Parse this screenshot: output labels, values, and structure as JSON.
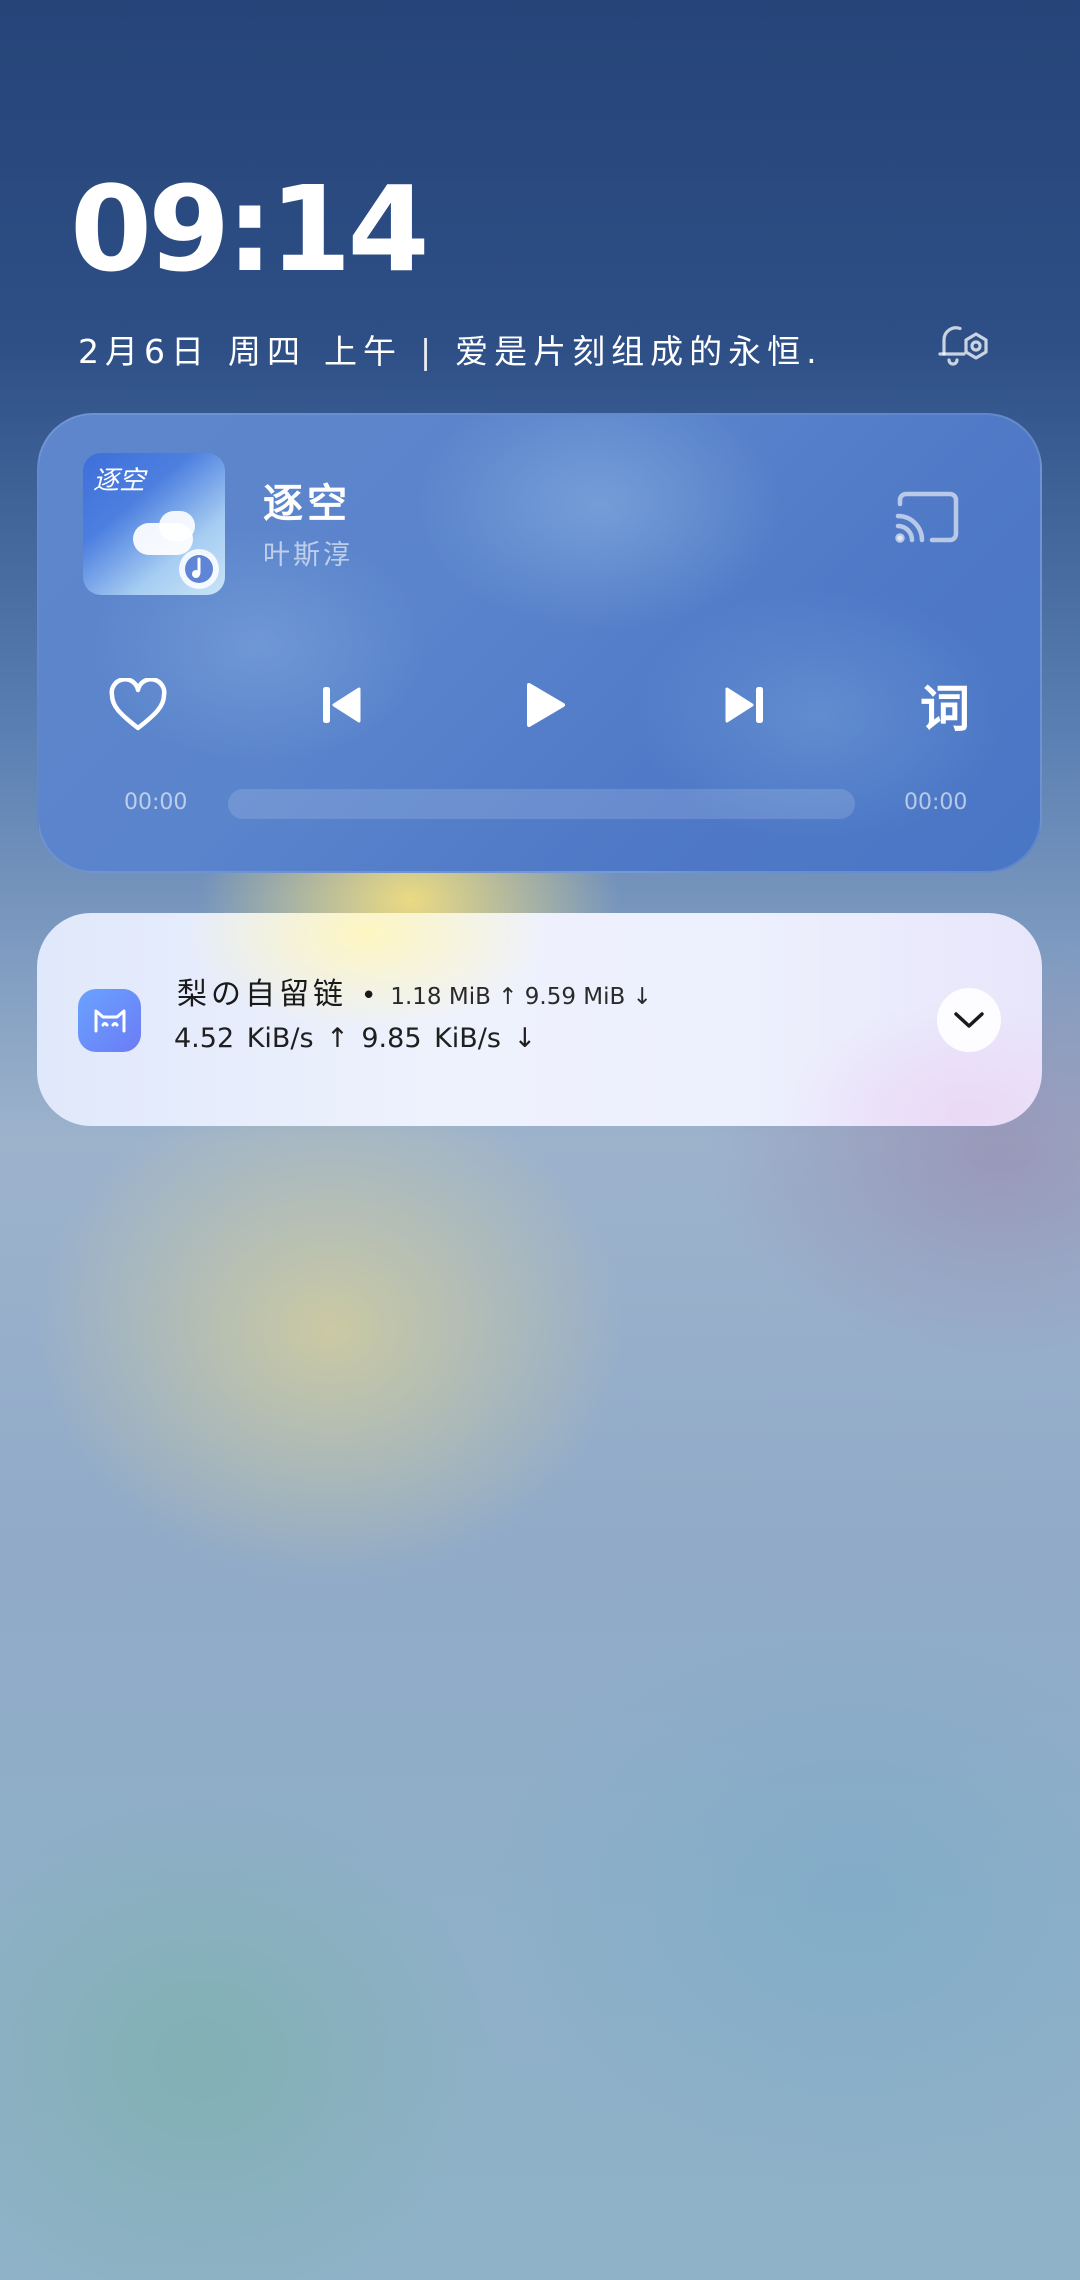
{
  "lockscreen": {
    "time": "09:14",
    "date": "2月6日",
    "weekday": "周四",
    "period": "上午",
    "separator": "|",
    "motto": "爱是片刻组成的永恒."
  },
  "music": {
    "title": "逐空",
    "artist": "叶斯淳",
    "album_art_text": "逐空",
    "lyrics_button": "词",
    "elapsed": "00:00",
    "duration": "00:00",
    "progress": 0
  },
  "notification": {
    "app_name": "梨の自留链",
    "dot": "•",
    "summary": "1.18 MiB ↑ 9.59 MiB ↓",
    "speed": "4.52 KiB/s ↑  9.85 KiB/s ↓"
  },
  "icons": {
    "alarm": "alarm-settings-icon",
    "cast": "cast-icon",
    "heart": "heart-icon",
    "previous": "skip-previous-icon",
    "play": "play-icon",
    "next": "skip-next-icon",
    "app": "cat-app-icon",
    "expand": "chevron-down-icon"
  },
  "colors": {
    "music_card": "#5a84cc",
    "notification_card": "#eef2fd",
    "app_icon": "#6b7cf5"
  }
}
